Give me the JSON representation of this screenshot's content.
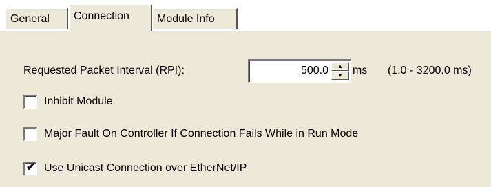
{
  "tabs": [
    {
      "label": "General"
    },
    {
      "label": "Connection"
    },
    {
      "label": "Module Info"
    }
  ],
  "active_tab": "Connection",
  "rpi": {
    "label": "Requested Packet Interval (RPI):",
    "value": "500.0",
    "units": "ms",
    "range": "(1.0 - 3200.0 ms)",
    "spin_up": "▲",
    "spin_down": "▼"
  },
  "options": [
    {
      "label": "Inhibit Module",
      "checked": false,
      "mark": ""
    },
    {
      "label": "Major Fault On Controller If Connection Fails While in Run Mode",
      "checked": false,
      "mark": ""
    },
    {
      "label": "Use Unicast Connection over EtherNet/IP",
      "checked": true,
      "mark": "✔"
    }
  ],
  "colors": {
    "background": "#ece9d8",
    "tabstrip_background": "#ffffff"
  }
}
